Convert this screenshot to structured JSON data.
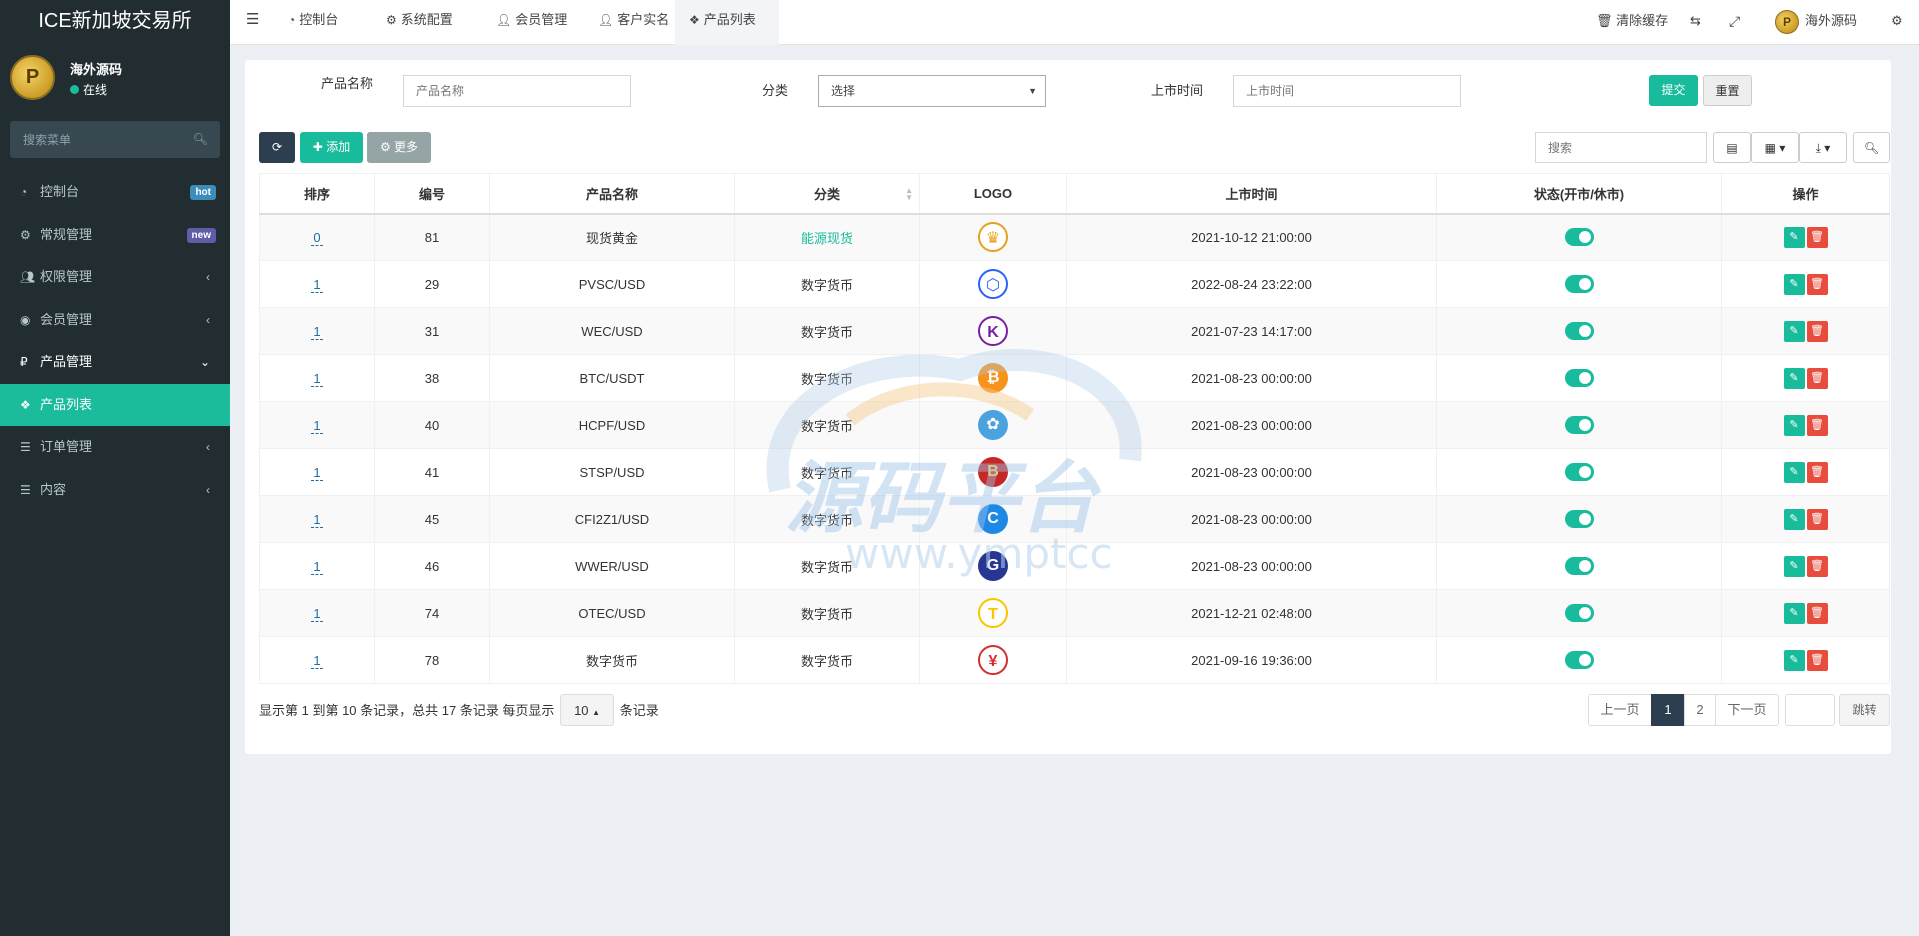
{
  "app": {
    "title": "ICE新加坡交易所"
  },
  "user": {
    "name": "海外源码",
    "status": "在线",
    "avatar_letter": "P"
  },
  "sidebar": {
    "search_placeholder": "搜索菜单",
    "items": [
      {
        "label": "控制台",
        "icon": "dashboard-icon",
        "badge": "hot"
      },
      {
        "label": "常规管理",
        "icon": "cogs-icon",
        "badge": "new"
      },
      {
        "label": "权限管理",
        "icon": "users-icon",
        "arrow": "‹"
      },
      {
        "label": "会员管理",
        "icon": "user-circle-icon",
        "arrow": "‹"
      },
      {
        "label": "产品管理",
        "icon": "product-icon",
        "arrow": "⌄"
      },
      {
        "label": "产品列表",
        "icon": "cubes-icon",
        "active": true
      },
      {
        "label": "订单管理",
        "icon": "list-icon",
        "arrow": "‹"
      },
      {
        "label": "内容",
        "icon": "list-icon",
        "arrow": "‹"
      }
    ]
  },
  "topbar": {
    "menu_icon": "hamburger-icon",
    "tabs": [
      {
        "label": "控制台",
        "icon": "dashboard-icon"
      },
      {
        "label": "系统配置",
        "icon": "gear-icon"
      },
      {
        "label": "会员管理",
        "icon": "user-icon"
      },
      {
        "label": "客户实名",
        "icon": "user-icon"
      },
      {
        "label": "产品列表",
        "icon": "cubes-icon"
      }
    ],
    "clear_cache": "清除缓存",
    "user_name": "海外源码"
  },
  "filter": {
    "name_label": "产品名称",
    "name_placeholder": "产品名称",
    "category_label": "分类",
    "category_value": "选择",
    "time_label": "上市时间",
    "time_placeholder": "上市时间",
    "submit": "提交",
    "reset": "重置"
  },
  "toolbar": {
    "add": "添加",
    "more": "更多",
    "search_placeholder": "搜索"
  },
  "table": {
    "headers": [
      "排序",
      "编号",
      "产品名称",
      "分类",
      "LOGO",
      "上市时间",
      "状态(开市/休市)",
      "操作"
    ],
    "rows": [
      {
        "weigh": "0",
        "id": "81",
        "name": "现货黄金",
        "category": "能源现货",
        "cat_link": true,
        "time": "2021-10-12 21:00:00",
        "logo": "gold"
      },
      {
        "weigh": "1",
        "id": "29",
        "name": "PVSC/USD",
        "category": "数字货币",
        "time": "2022-08-24 23:22:00",
        "logo": "hexagon"
      },
      {
        "weigh": "1",
        "id": "31",
        "name": "WEC/USD",
        "category": "数字货币",
        "time": "2021-07-23 14:17:00",
        "logo": "k"
      },
      {
        "weigh": "1",
        "id": "38",
        "name": "BTC/USDT",
        "category": "数字货币",
        "time": "2021-08-23 00:00:00",
        "logo": "btc"
      },
      {
        "weigh": "1",
        "id": "40",
        "name": "HCPF/USD",
        "category": "数字货币",
        "time": "2021-08-23 00:00:00",
        "logo": "hcpf"
      },
      {
        "weigh": "1",
        "id": "41",
        "name": "STSP/USD",
        "category": "数字货币",
        "time": "2021-08-23 00:00:00",
        "logo": "stsp"
      },
      {
        "weigh": "1",
        "id": "45",
        "name": "CFI2Z1/USD",
        "category": "数字货币",
        "time": "2021-08-23 00:00:00",
        "logo": "cfi"
      },
      {
        "weigh": "1",
        "id": "46",
        "name": "WWER/USD",
        "category": "数字货币",
        "time": "2021-08-23 00:00:00",
        "logo": "wwer"
      },
      {
        "weigh": "1",
        "id": "74",
        "name": "OTEC/USD",
        "category": "数字货币",
        "time": "2021-12-21 02:48:00",
        "logo": "otec"
      },
      {
        "weigh": "1",
        "id": "78",
        "name": "数字货币",
        "category": "数字货币",
        "time": "2021-09-16 19:36:00",
        "logo": "yuan"
      }
    ]
  },
  "pagination": {
    "info_prefix": "显示第 1 到第 10 条记录，总共 17 条记录 每页显示",
    "page_size": "10",
    "info_suffix": "条记录",
    "prev": "上一页",
    "pages": [
      "1",
      "2"
    ],
    "next": "下一页",
    "jump": "跳转"
  },
  "watermark": {
    "title": "源码平台",
    "url": "www.ymptcc"
  },
  "colors": {
    "accent": "#18bc9c",
    "sidebar": "#222d32",
    "danger": "#e74c3c",
    "dark": "#2c3e50"
  }
}
